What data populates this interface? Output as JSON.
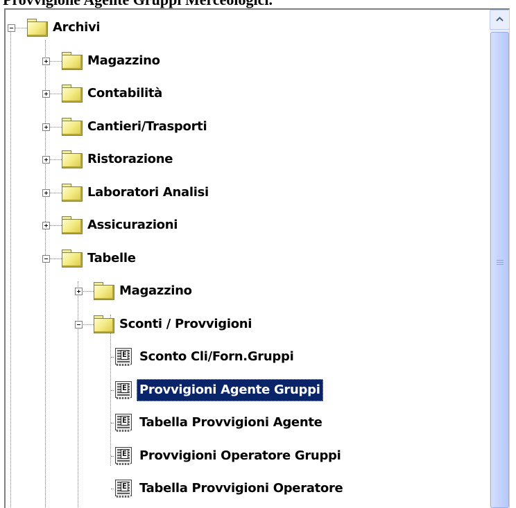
{
  "page": {
    "title": "Provvigione Agente Gruppi Merceologici."
  },
  "tree": {
    "nodes": [
      {
        "label": "Archivi",
        "expander": "minus",
        "icon": "folder-icon"
      },
      {
        "label": "Magazzino",
        "expander": "plus",
        "icon": "folder-icon"
      },
      {
        "label": "Contabilità",
        "expander": "plus",
        "icon": "folder-icon"
      },
      {
        "label": "Cantieri/Trasporti",
        "expander": "plus",
        "icon": "folder-icon"
      },
      {
        "label": "Ristorazione",
        "expander": "plus",
        "icon": "folder-icon"
      },
      {
        "label": "Laboratori Analisi",
        "expander": "plus",
        "icon": "folder-icon"
      },
      {
        "label": "Assicurazioni",
        "expander": "plus",
        "icon": "folder-icon"
      },
      {
        "label": "Tabelle",
        "expander": "minus",
        "icon": "folder-icon"
      },
      {
        "label": "Magazzino",
        "expander": "plus",
        "icon": "folder-icon"
      },
      {
        "label": "Sconti / Provvigioni",
        "expander": "minus",
        "icon": "folder-icon"
      },
      {
        "label": "Sconto Cli/Forn.Gruppi",
        "icon": "report-icon",
        "icon_letter": "E"
      },
      {
        "label": "Provvigioni Agente Gruppi",
        "icon": "report-icon",
        "icon_letter": "E",
        "selected": true
      },
      {
        "label": "Tabella Provvigioni Agente",
        "icon": "report-icon",
        "icon_letter": "E"
      },
      {
        "label": "Provvigioni Operatore Gruppi",
        "icon": "report-icon",
        "icon_letter": "E"
      },
      {
        "label": "Tabella Provvigioni Operatore",
        "icon": "report-icon",
        "icon_letter": "E"
      }
    ]
  },
  "colors": {
    "selection_bg": "#0a246a",
    "selection_fg": "#ffffff",
    "folder": "#f5ec86",
    "scrollbar_thumb": "#c3d3fd"
  }
}
